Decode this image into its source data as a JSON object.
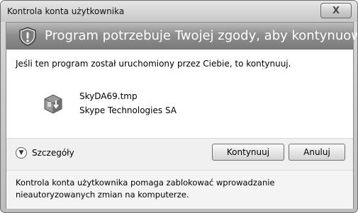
{
  "window": {
    "title": "Kontrola konta użytkownika",
    "close_glyph": "X"
  },
  "banner": {
    "icon": "shield-warning-icon",
    "text": "Program potrzebuje Twojej zgody, aby kontynuować"
  },
  "content": {
    "prompt": "Jeśli ten program został uruchomiony przez Ciebie, to kontynuuj.",
    "program": {
      "icon": "installer-icon",
      "name": "SkyDA69.tmp",
      "publisher": "Skype Technologies SA"
    }
  },
  "actions": {
    "details_icon": "chevron-down-icon",
    "details_label": "Szczegóły",
    "continue_label": "Kontynuuj",
    "cancel_label": "Anuluj"
  },
  "footer": {
    "text": "Kontrola konta użytkownika pomaga zablokować wprowadzanie nieautoryzowanych zmian na komputerze."
  }
}
